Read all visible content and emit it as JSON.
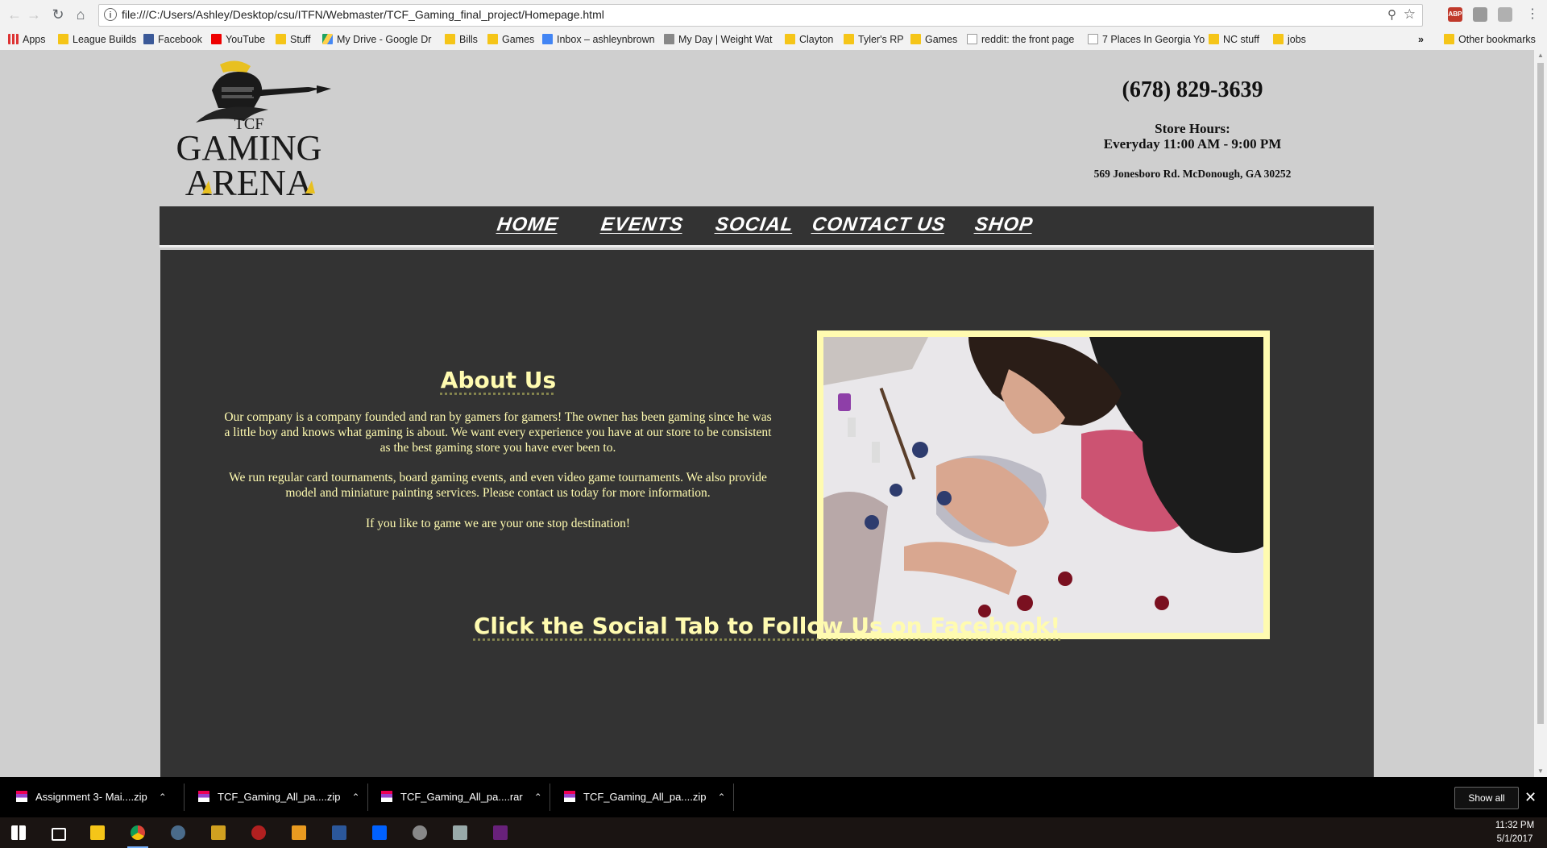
{
  "browser": {
    "url": "file:///C:/Users/Ashley/Desktop/csu/ITFN/Webmaster/TCF_Gaming_final_project/Homepage.html",
    "extensions": [
      "ABP"
    ],
    "bookmarks": [
      {
        "label": "Apps",
        "icon": "apps-grid-icon"
      },
      {
        "label": "League Builds",
        "icon": "folder-icon"
      },
      {
        "label": "Facebook",
        "icon": "facebook-icon"
      },
      {
        "label": "YouTube",
        "icon": "youtube-icon"
      },
      {
        "label": "Stuff",
        "icon": "folder-icon"
      },
      {
        "label": "My Drive - Google Dr",
        "icon": "google-drive-icon"
      },
      {
        "label": "Bills",
        "icon": "folder-icon"
      },
      {
        "label": "Games",
        "icon": "folder-icon"
      },
      {
        "label": "Inbox – ashleynbrown",
        "icon": "mail-icon"
      },
      {
        "label": "My Day | Weight Wat",
        "icon": "weight-watchers-icon"
      },
      {
        "label": "Clayton",
        "icon": "folder-icon"
      },
      {
        "label": "Tyler's RP",
        "icon": "folder-icon"
      },
      {
        "label": "Games",
        "icon": "folder-icon"
      },
      {
        "label": "reddit: the front page",
        "icon": "reddit-icon"
      },
      {
        "label": "7 Places In Georgia Yo",
        "icon": "page-icon"
      },
      {
        "label": "NC stuff",
        "icon": "folder-icon"
      },
      {
        "label": "jobs",
        "icon": "folder-icon"
      }
    ],
    "overflow_label": "»",
    "other_bookmarks": "Other bookmarks"
  },
  "site": {
    "logo": {
      "line1": "TCF",
      "line2": "GAMING",
      "line3": "ARENA"
    },
    "phone": "(678) 829-3639",
    "hours_label": "Store Hours:",
    "hours_value": "Everyday 11:00 AM - 9:00 PM",
    "address": "569 Jonesboro Rd. McDonough, GA 30252",
    "nav": [
      "HOME",
      "EVENTS",
      "SOCIAL",
      "CONTACT US",
      "SHOP"
    ],
    "about": {
      "title": "About Us",
      "p1": "Our company is a company founded and ran by gamers for gamers! The owner has been gaming since he was a little boy and knows what gaming is about. We want every experience you have at our store to be consistent as the best gaming store you have ever been to.",
      "p2": "We run regular card tournaments, board gaming events, and even video game tournaments. We also provide model and miniature painting services. Please contact us today for more information.",
      "p3": "If you like to game we are your one stop destination!"
    },
    "cta": "Click the Social Tab to Follow Us on Facebook!",
    "colors": {
      "accent": "#fffbb0",
      "panel": "#333333",
      "background": "#cfcfcf"
    }
  },
  "downloads": {
    "items": [
      "Assignment 3- Mai....zip",
      "TCF_Gaming_All_pa....zip",
      "TCF_Gaming_All_pa....rar",
      "TCF_Gaming_All_pa....zip"
    ],
    "show_all": "Show all"
  },
  "taskbar": {
    "time": "11:32 PM",
    "date": "5/1/2017",
    "apps": [
      "windows-start-icon",
      "task-view-icon",
      "file-explorer-icon",
      "chrome-icon",
      "steam-icon",
      "app-icon",
      "game-icon",
      "game-icon",
      "word-icon",
      "dropbox-icon",
      "app-icon",
      "app-icon",
      "visual-studio-icon"
    ]
  }
}
